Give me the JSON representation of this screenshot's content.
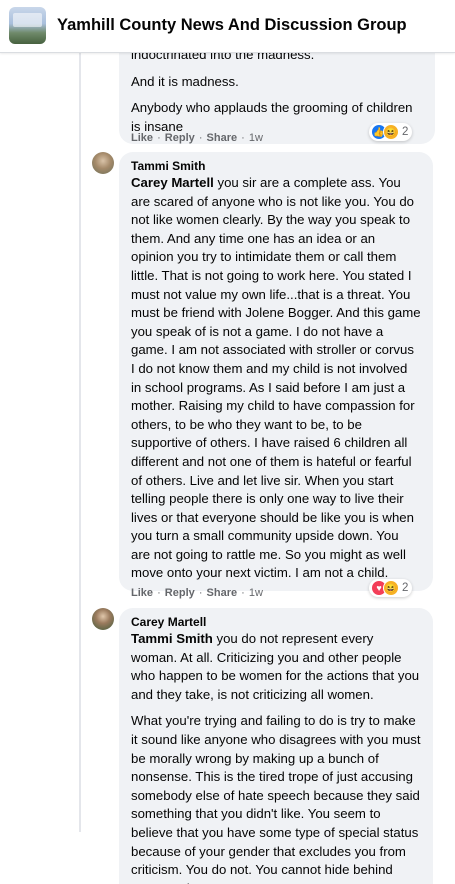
{
  "header": {
    "group_name": "Yamhill County News And Discussion Group"
  },
  "comments": [
    {
      "author": "",
      "paragraphs": [
        "indoctrinated into the madness.",
        "And it is madness.",
        "Anybody who applauds the grooming of children is insane"
      ],
      "actions": {
        "like": "Like",
        "reply": "Reply",
        "share": "Share",
        "time": "1w"
      },
      "reactions": {
        "types": [
          "like-icon",
          "haha-icon"
        ],
        "count": "2"
      }
    },
    {
      "author": "Tammi Smith",
      "mention": "Carey Martell",
      "paragraphs": [
        " you sir are a complete ass. You are scared of anyone who is not like you. You do not like women clearly. By the way you speak to them. And any time one has an idea or an opinion you try to intimidate them or call them little. That is not going to work here. You stated I must not value my own life...that is a threat. You must be friend with Jolene Bogger. And this game you speak of is not a game. I do not have a game. I am not associated with stroller or corvus I do not know them and my child is not involved in school programs. As I said before I am just a mother. Raising my child to have compassion for others, to be who they want to be, to be supportive of others. I have raised 6 children all different and not one of them is hateful or fearful of others. Live and let live sir. When you start telling people there is only one way to live their lives or that everyone should be like you is when you turn a small community upside down. You are not going to rattle me. So you might as well move onto your next victim. I am not a child."
      ],
      "actions": {
        "like": "Like",
        "reply": "Reply",
        "share": "Share",
        "time": "1w"
      },
      "reactions": {
        "types": [
          "love-icon",
          "haha-icon"
        ],
        "count": "2"
      }
    },
    {
      "author": "Carey Martell",
      "mention": "Tammi Smith",
      "paragraphs": [
        " you do not represent every woman. At all. Criticizing you and other people who happen to be women for the actions that you and they take, is not criticizing all women.",
        "What you're trying and failing to do is try to make it sound like anyone who disagrees with you must be morally wrong by making up a bunch of nonsense. This is the tired trope of just accusing somebody else of hate speech because they said something that you didn't like. You seem to believe that you have some type of special status because of your gender that excludes you from criticism. You do not. You cannot hide behind your gender"
      ]
    }
  ],
  "colors": {
    "bubble_bg": "#f0f2f5",
    "meta_text": "#65676b",
    "like_blue": "#1877f2",
    "love_red": "#f33e58",
    "haha_yellow": "#f7b125"
  }
}
